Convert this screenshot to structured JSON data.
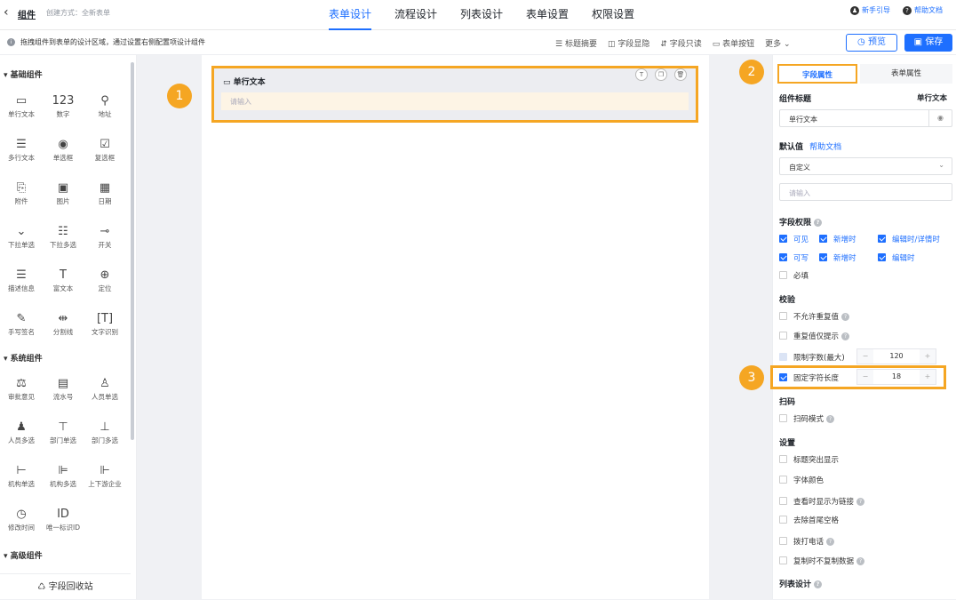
{
  "header": {
    "app_name": "组件",
    "created": "创建方式：全新表单",
    "tabs": [
      "表单设计",
      "流程设计",
      "列表设计",
      "表单设置",
      "权限设置"
    ],
    "guide": "新手引导",
    "help": "帮助文档"
  },
  "toolbar": {
    "tip": "拖拽组件到表单的设计区域，通过设置右侧配置项设计组件",
    "tools": [
      "标题摘要",
      "字段显隐",
      "字段只读",
      "表单按钮",
      "更多"
    ],
    "preview": "预览",
    "save": "保存"
  },
  "left": {
    "sections": [
      "基础组件",
      "系统组件",
      "高级组件"
    ],
    "basic": [
      {
        "icon": "▭",
        "label": "单行文本"
      },
      {
        "icon": "123",
        "label": "数字"
      },
      {
        "icon": "⚲",
        "label": "地址"
      },
      {
        "icon": "☰",
        "label": "多行文本"
      },
      {
        "icon": "◉",
        "label": "单选框"
      },
      {
        "icon": "☑",
        "label": "复选框"
      },
      {
        "icon": "⎘",
        "label": "附件"
      },
      {
        "icon": "▣",
        "label": "图片"
      },
      {
        "icon": "▦",
        "label": "日期"
      },
      {
        "icon": "⌄",
        "label": "下拉单选"
      },
      {
        "icon": "☷",
        "label": "下拉多选"
      },
      {
        "icon": "⊸",
        "label": "开关"
      },
      {
        "icon": "☰",
        "label": "描述信息"
      },
      {
        "icon": "T",
        "label": "富文本"
      },
      {
        "icon": "⊕",
        "label": "定位"
      },
      {
        "icon": "✎",
        "label": "手写签名"
      },
      {
        "icon": "⇹",
        "label": "分割线"
      },
      {
        "icon": "[T]",
        "label": "文字识别"
      }
    ],
    "system": [
      {
        "icon": "⚖",
        "label": "审批意见"
      },
      {
        "icon": "▤",
        "label": "流水号"
      },
      {
        "icon": "♙",
        "label": "人员单选"
      },
      {
        "icon": "♟",
        "label": "人员多选"
      },
      {
        "icon": "⊤",
        "label": "部门单选"
      },
      {
        "icon": "⊥",
        "label": "部门多选"
      },
      {
        "icon": "⊢",
        "label": "机构单选"
      },
      {
        "icon": "⊫",
        "label": "机构多选"
      },
      {
        "icon": "⊩",
        "label": "上下游企业"
      },
      {
        "icon": "◷",
        "label": "修改时间"
      },
      {
        "icon": "ID",
        "label": "唯一标识ID"
      }
    ],
    "recycle": "字段回收站"
  },
  "canvas": {
    "field_title": "单行文本",
    "placeholder": "请输入",
    "badges": [
      "1",
      "2",
      "3"
    ]
  },
  "right": {
    "tab_field": "字段属性",
    "tab_form": "表单属性",
    "title_label": "组件标题",
    "title_value_right": "单行文本",
    "title_value": "单行文本",
    "default_label": "默认值",
    "help_doc": "帮助文档",
    "default_select": "自定义",
    "default_placeholder": "请输入",
    "perm_label": "字段权限",
    "perm_visible": "可见",
    "perm_new": "新增时",
    "perm_edit_detail": "编辑时/详情时",
    "perm_write": "可写",
    "perm_new2": "新增时",
    "perm_edit": "编辑时",
    "required": "必填",
    "validate_label": "校验",
    "no_dup": "不允许重复值",
    "dup_tip": "重复值仅提示",
    "limit_label": "限制字数(最大)",
    "limit_value": "120",
    "fixed_label": "固定字符长度",
    "fixed_value": "18",
    "scan_label": "扫码",
    "scan_mode": "扫码模式",
    "settings_label": "设置",
    "s1": "标题突出显示",
    "s2": "字体颜色",
    "s3": "查看时显示为链接",
    "s4": "去除首尾空格",
    "s5": "拨打电话",
    "s6": "复制时不复制数据",
    "list_label": "列表设计"
  }
}
